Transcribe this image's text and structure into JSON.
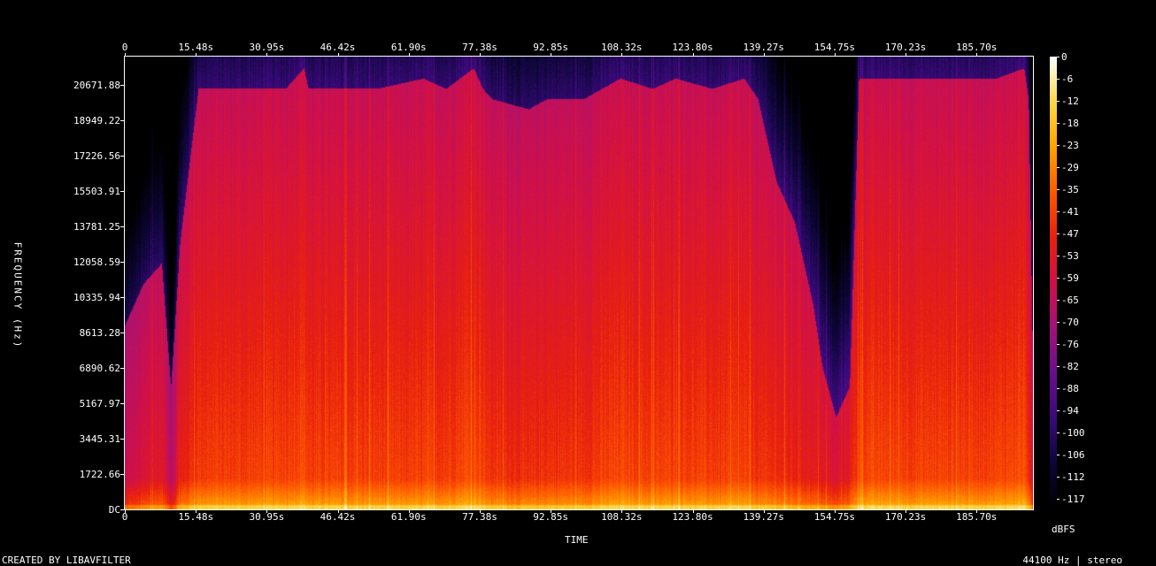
{
  "chart_data": {
    "type": "heatmap",
    "title": "",
    "xlabel": "TIME",
    "ylabel": "FREQUENCY (Hz)",
    "x_ticks": [
      "0",
      "15.48s",
      "30.95s",
      "46.42s",
      "61.90s",
      "77.38s",
      "92.85s",
      "108.32s",
      "123.80s",
      "139.27s",
      "154.75s",
      "170.23s",
      "185.70s"
    ],
    "x_tick_values": [
      0,
      15.48,
      30.95,
      46.42,
      61.9,
      77.38,
      92.85,
      108.32,
      123.8,
      139.27,
      154.75,
      170.23,
      185.7
    ],
    "xlim": [
      0,
      198.0
    ],
    "y_ticks": [
      "DC",
      "1722.66",
      "3445.31",
      "5167.97",
      "6890.62",
      "8613.28",
      "10335.94",
      "12058.59",
      "13781.25",
      "15503.91",
      "17226.56",
      "18949.22",
      "20671.88"
    ],
    "y_tick_values": [
      0,
      1722.66,
      3445.31,
      5167.97,
      6890.62,
      8613.28,
      10335.94,
      12058.59,
      13781.25,
      15503.91,
      17226.56,
      18949.22,
      20671.88
    ],
    "ylim": [
      0,
      22050
    ],
    "colorbar": {
      "label": "dBFS",
      "ticks": [
        "0",
        "-6",
        "-12",
        "-18",
        "-23",
        "-29",
        "-35",
        "-41",
        "-47",
        "-53",
        "-59",
        "-65",
        "-70",
        "-76",
        "-82",
        "-88",
        "-94",
        "-100",
        "-106",
        "-112",
        "-117"
      ],
      "range": [
        -120,
        0
      ],
      "colormap": [
        "#000000",
        "#0d0638",
        "#3a0a7a",
        "#6a0f8c",
        "#a3127a",
        "#d0104a",
        "#e8200e",
        "#ff5a00",
        "#ffa200",
        "#ffd84a",
        "#ffffff"
      ]
    },
    "loudness_profile": {
      "times": [
        0,
        4,
        8,
        10,
        12,
        16,
        25,
        35,
        39,
        40,
        45,
        55,
        65,
        70,
        76,
        78,
        80,
        88,
        92,
        100,
        108,
        115,
        120,
        128,
        135,
        138,
        142,
        146,
        150,
        152,
        155,
        158,
        160,
        170,
        180,
        190,
        196,
        197,
        198
      ],
      "cutoff_hz": [
        9000,
        11000,
        12000,
        6000,
        13000,
        20500,
        20500,
        20500,
        21500,
        20500,
        20500,
        20500,
        21000,
        20500,
        21500,
        20500,
        20000,
        19500,
        20000,
        20000,
        21000,
        20500,
        21000,
        20500,
        21000,
        20000,
        16000,
        14000,
        10000,
        7000,
        4500,
        6000,
        21000,
        21000,
        21000,
        21000,
        21500,
        20000,
        6000
      ],
      "level_db": [
        -60,
        -55,
        -50,
        -65,
        -48,
        -40,
        -40,
        -39,
        -36,
        -40,
        -40,
        -40,
        -40,
        -40,
        -36,
        -40,
        -42,
        -44,
        -42,
        -42,
        -38,
        -40,
        -39,
        -40,
        -40,
        -42,
        -44,
        -46,
        -48,
        -50,
        -55,
        -48,
        -38,
        -39,
        -39,
        -39,
        -36,
        -42,
        -70
      ]
    }
  },
  "footer": {
    "left": "CREATED BY LIBAVFILTER",
    "right": "44100 Hz | stereo"
  }
}
